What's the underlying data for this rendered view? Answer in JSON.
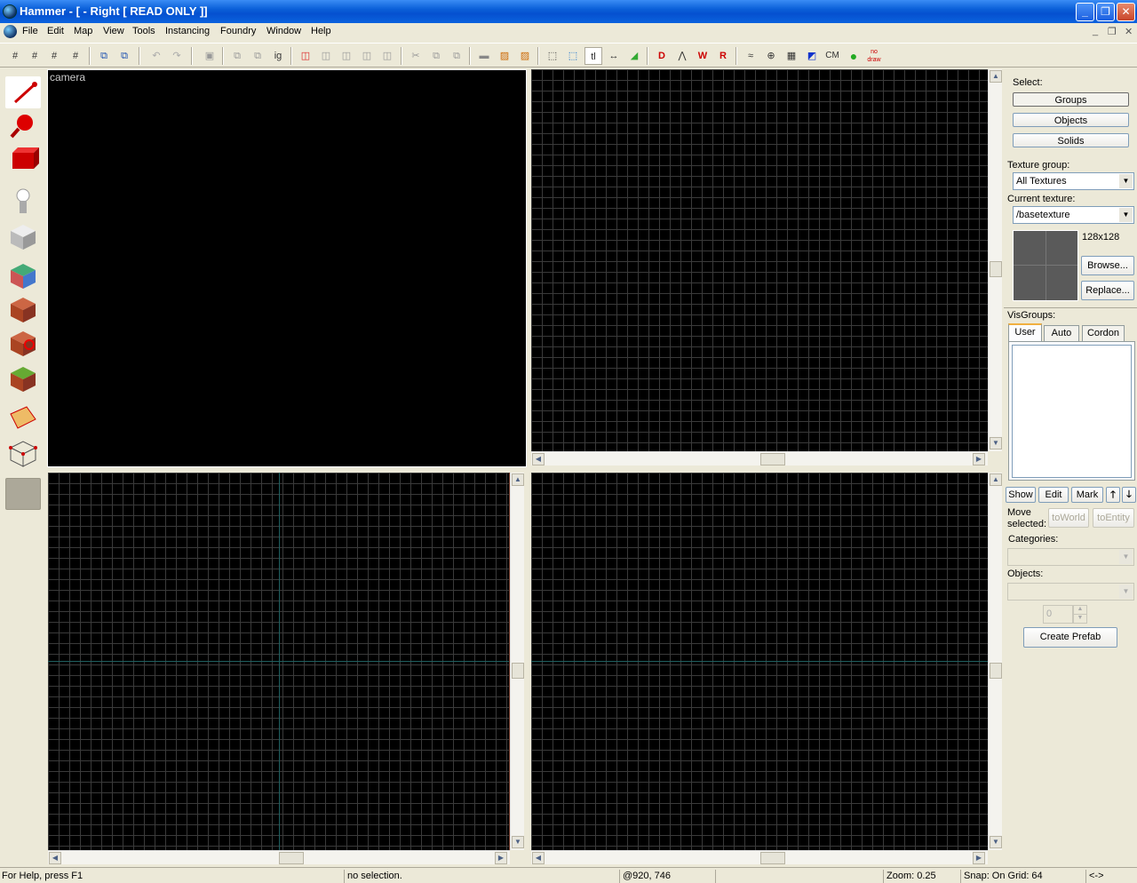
{
  "window": {
    "title": "Hammer - [ - Right [ READ ONLY ]]",
    "minimize_icon": "minimize-icon",
    "restore_icon": "restore-icon",
    "close_icon": "close-icon",
    "min_glyph": "_",
    "restore_glyph": "❐",
    "close_glyph": "✕"
  },
  "menu": {
    "items": [
      "File",
      "Edit",
      "Map",
      "View",
      "Tools",
      "Instancing",
      "Foundry",
      "Window",
      "Help"
    ],
    "mdi_glyphs": [
      "_",
      "❐",
      "✕"
    ]
  },
  "toolbar": {
    "buttons": [
      "#",
      "#",
      "#",
      "#",
      "⧉",
      "⧉",
      "↶",
      "↷",
      "▣",
      "⧉",
      "⧉",
      "ig",
      "◫",
      "◫",
      "◫",
      "◫",
      "◫",
      "✂",
      "⧉",
      "⧉",
      "▬",
      "▨",
      "▨",
      "⬚",
      "⬚",
      "tl",
      "↔",
      "◢",
      "D",
      "⋀",
      "W",
      "R",
      "≈",
      "⊕",
      "▦",
      "◩",
      "CM",
      "●",
      "no draw"
    ]
  },
  "tools": [
    "selection-tool",
    "magnify-tool",
    "camera-tool",
    "entity-tool",
    "block-tool",
    "texture-tool",
    "apply-texture-tool",
    "decal-tool",
    "overlay-tool",
    "clipping-tool",
    "vertex-tool",
    "path-tool"
  ],
  "viewports": {
    "camera_label": "camera"
  },
  "right_panel": {
    "select_label": "Select:",
    "groups_button": "Groups",
    "objects_button": "Objects",
    "solids_button": "Solids",
    "texture_group_label": "Texture group:",
    "texture_group_value": "All Textures",
    "current_texture_label": "Current texture:",
    "current_texture_value": "/basetexture",
    "texture_size": "128x128",
    "browse_button": "Browse...",
    "replace_button": "Replace...",
    "visgroups_label": "VisGroups:",
    "tabs": [
      "User",
      "Auto",
      "Cordon"
    ],
    "show_button": "Show",
    "edit_button": "Edit",
    "mark_button": "Mark",
    "up_glyph": "🡑",
    "down_glyph": "🡓",
    "move_selected_label_1": "Move",
    "move_selected_label_2": "selected:",
    "to_world_button": "toWorld",
    "to_entity_button": "toEntity",
    "categories_label": "Categories:",
    "objects_label": "Objects:",
    "spinner_value": "0",
    "create_prefab_button": "Create Prefab"
  },
  "status": {
    "help": "For Help, press F1",
    "selection": "no selection.",
    "coords": "@920, 746",
    "zoom": "Zoom: 0.25",
    "snap": "Snap: On Grid: 64",
    "arrows": "<->"
  },
  "colors": {
    "title_bar": "#0a5fd8",
    "viewport_bg": "#000000",
    "grid_line": "#3a3a3a",
    "axis_line": "#1f5f5f"
  }
}
